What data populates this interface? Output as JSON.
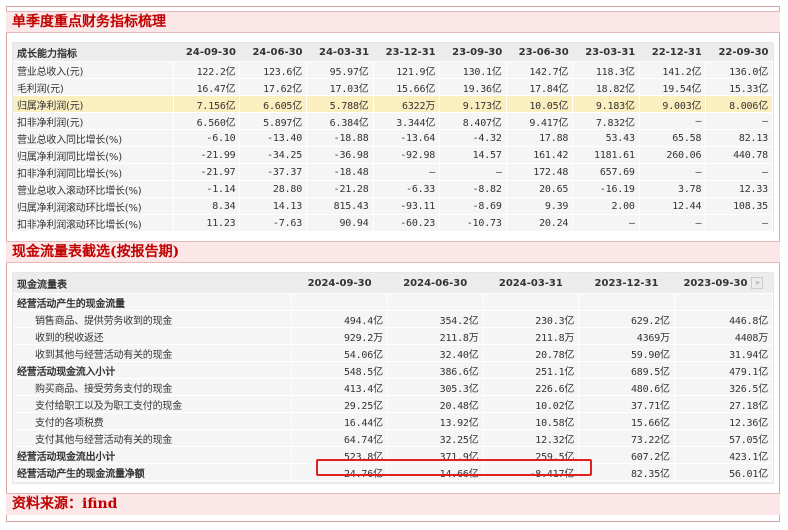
{
  "section1_title": "单季度重点财务指标梳理",
  "table1": {
    "header": [
      "成长能力指标",
      "24-09-30",
      "24-06-30",
      "24-03-31",
      "23-12-31",
      "23-09-30",
      "23-06-30",
      "23-03-31",
      "22-12-31",
      "22-09-30"
    ],
    "rows": [
      [
        "营业总收入(元)",
        "122.2亿",
        "123.6亿",
        "95.97亿",
        "121.9亿",
        "130.1亿",
        "142.7亿",
        "118.3亿",
        "141.2亿",
        "136.0亿"
      ],
      [
        "毛利润(元)",
        "16.47亿",
        "17.62亿",
        "17.03亿",
        "15.66亿",
        "19.36亿",
        "17.84亿",
        "18.82亿",
        "19.54亿",
        "15.33亿"
      ],
      [
        "归属净利润(元)",
        "7.156亿",
        "6.605亿",
        "5.788亿",
        "6322万",
        "9.173亿",
        "10.05亿",
        "9.183亿",
        "9.003亿",
        "8.006亿"
      ],
      [
        "扣非净利润(元)",
        "6.560亿",
        "5.897亿",
        "6.384亿",
        "3.344亿",
        "8.407亿",
        "9.417亿",
        "7.832亿",
        "—",
        "—"
      ],
      [
        "营业总收入同比增长(%)",
        "-6.10",
        "-13.40",
        "-18.88",
        "-13.64",
        "-4.32",
        "17.88",
        "53.43",
        "65.58",
        "82.13"
      ],
      [
        "归属净利润同比增长(%)",
        "-21.99",
        "-34.25",
        "-36.98",
        "-92.98",
        "14.57",
        "161.42",
        "1181.61",
        "260.06",
        "440.78"
      ],
      [
        "扣非净利润同比增长(%)",
        "-21.97",
        "-37.37",
        "-18.48",
        "—",
        "—",
        "172.48",
        "657.69",
        "—",
        "—"
      ],
      [
        "营业总收入滚动环比增长(%)",
        "-1.14",
        "28.80",
        "-21.28",
        "-6.33",
        "-8.82",
        "20.65",
        "-16.19",
        "3.78",
        "12.33"
      ],
      [
        "归属净利润滚动环比增长(%)",
        "8.34",
        "14.13",
        "815.43",
        "-93.11",
        "-8.69",
        "9.39",
        "2.00",
        "12.44",
        "108.35"
      ],
      [
        "扣非净利润滚动环比增长(%)",
        "11.23",
        "-7.63",
        "90.94",
        "-60.23",
        "-10.73",
        "20.24",
        "—",
        "—",
        "—"
      ]
    ]
  },
  "section2_title": "现金流量表截选(按报告期)",
  "table2": {
    "header": [
      "现金流量表",
      "2024-09-30",
      "2024-06-30",
      "2024-03-31",
      "2023-12-31",
      "2023-09-30"
    ],
    "more_icon": "»",
    "rows": [
      {
        "label": "经营活动产生的现金流量",
        "bold": true,
        "indent": false,
        "values": [
          "",
          "",
          "",
          "",
          ""
        ]
      },
      {
        "label": "销售商品、提供劳务收到的现金",
        "bold": false,
        "indent": true,
        "values": [
          "494.4亿",
          "354.2亿",
          "230.3亿",
          "629.2亿",
          "446.8亿"
        ]
      },
      {
        "label": "收到的税收返还",
        "bold": false,
        "indent": true,
        "values": [
          "929.2万",
          "211.8万",
          "211.8万",
          "4369万",
          "4408万"
        ]
      },
      {
        "label": "收到其他与经营活动有关的现金",
        "bold": false,
        "indent": true,
        "values": [
          "54.06亿",
          "32.40亿",
          "20.78亿",
          "59.90亿",
          "31.94亿"
        ]
      },
      {
        "label": "经营活动现金流入小计",
        "bold": true,
        "indent": false,
        "values": [
          "548.5亿",
          "386.6亿",
          "251.1亿",
          "689.5亿",
          "479.1亿"
        ]
      },
      {
        "label": "购买商品、接受劳务支付的现金",
        "bold": false,
        "indent": true,
        "values": [
          "413.4亿",
          "305.3亿",
          "226.6亿",
          "480.6亿",
          "326.5亿"
        ]
      },
      {
        "label": "支付给职工以及为职工支付的现金",
        "bold": false,
        "indent": true,
        "values": [
          "29.25亿",
          "20.48亿",
          "10.02亿",
          "37.71亿",
          "27.18亿"
        ]
      },
      {
        "label": "支付的各项税费",
        "bold": false,
        "indent": true,
        "values": [
          "16.44亿",
          "13.92亿",
          "10.58亿",
          "15.66亿",
          "12.36亿"
        ]
      },
      {
        "label": "支付其他与经营活动有关的现金",
        "bold": false,
        "indent": true,
        "values": [
          "64.74亿",
          "32.25亿",
          "12.32亿",
          "73.22亿",
          "57.05亿"
        ]
      },
      {
        "label": "经营活动现金流出小计",
        "bold": true,
        "indent": false,
        "values": [
          "523.8亿",
          "371.9亿",
          "259.5亿",
          "607.2亿",
          "423.1亿"
        ]
      },
      {
        "label": "经营活动产生的现金流量净额",
        "bold": true,
        "indent": false,
        "values": [
          "24.76亿",
          "14.66亿",
          "-8.417亿",
          "82.35亿",
          "56.01亿"
        ]
      }
    ]
  },
  "footer_text": "资料来源：ifind",
  "colors": {
    "title_red": "#c00000",
    "highlight_row": "#fcefbf",
    "annotation_box": "#e02020"
  }
}
